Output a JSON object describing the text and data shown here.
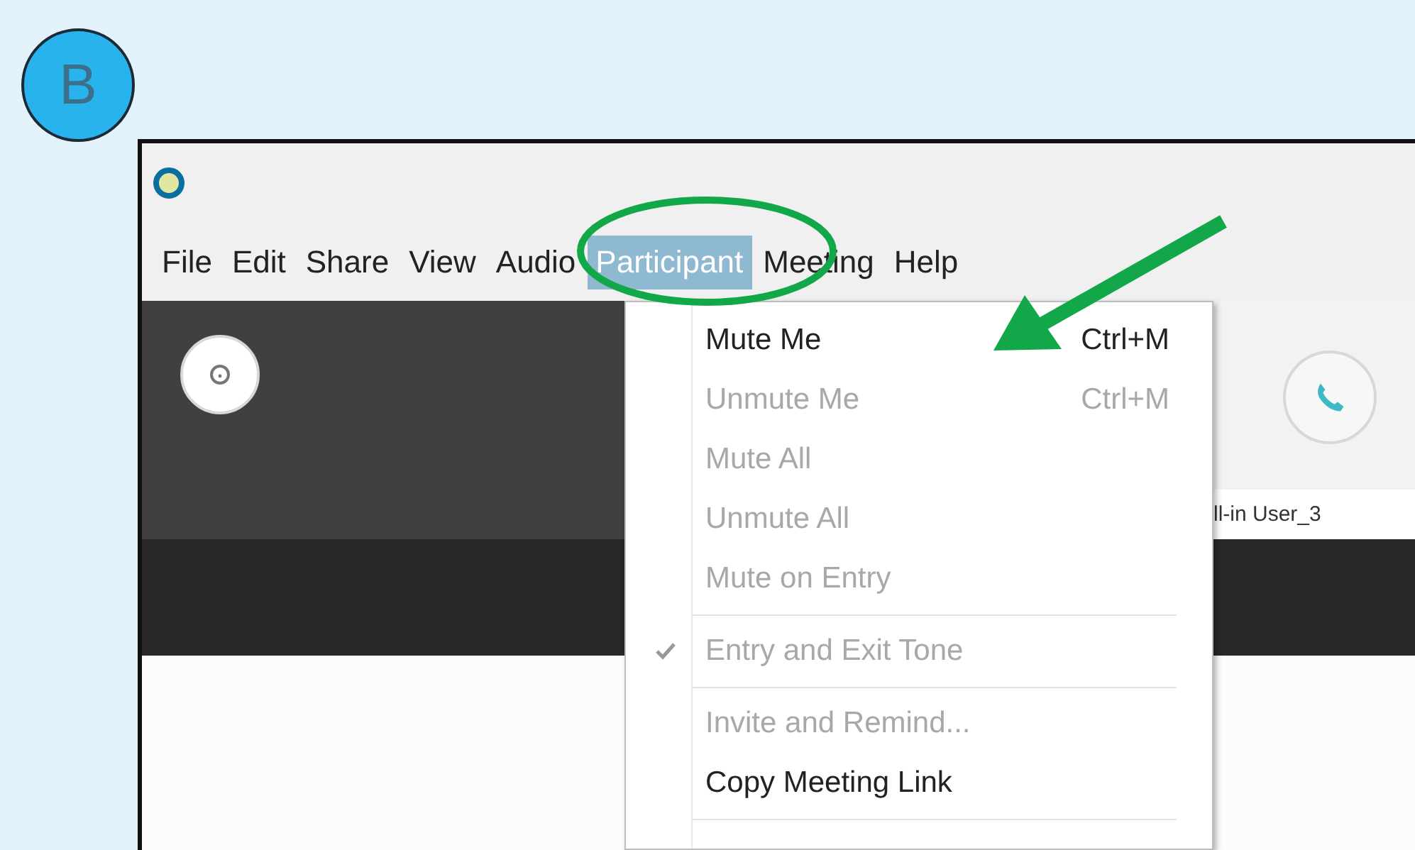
{
  "badge": "B",
  "menubar": [
    {
      "label": "File",
      "selected": false
    },
    {
      "label": "Edit",
      "selected": false
    },
    {
      "label": "Share",
      "selected": false
    },
    {
      "label": "View",
      "selected": false
    },
    {
      "label": "Audio",
      "selected": false
    },
    {
      "label": "Participant",
      "selected": true
    },
    {
      "label": "Meeting",
      "selected": false
    },
    {
      "label": "Help",
      "selected": false
    }
  ],
  "participant_label": "ll-in User_3",
  "menu": [
    {
      "kind": "item",
      "label": "Mute Me",
      "shortcut": "Ctrl+M",
      "disabled": false,
      "checked": false
    },
    {
      "kind": "item",
      "label": "Unmute Me",
      "shortcut": "Ctrl+M",
      "disabled": true,
      "checked": false
    },
    {
      "kind": "item",
      "label": "Mute All",
      "disabled": true,
      "checked": false
    },
    {
      "kind": "item",
      "label": "Unmute All",
      "disabled": true,
      "checked": false
    },
    {
      "kind": "item",
      "label": "Mute on Entry",
      "disabled": true,
      "checked": false
    },
    {
      "kind": "separator"
    },
    {
      "kind": "item",
      "label": "Entry and Exit Tone",
      "disabled": true,
      "checked": true
    },
    {
      "kind": "separator"
    },
    {
      "kind": "item",
      "label": "Invite and Remind...",
      "disabled": true,
      "checked": false
    },
    {
      "kind": "item",
      "label": "Copy Meeting Link",
      "disabled": false,
      "checked": false
    },
    {
      "kind": "separator"
    }
  ]
}
